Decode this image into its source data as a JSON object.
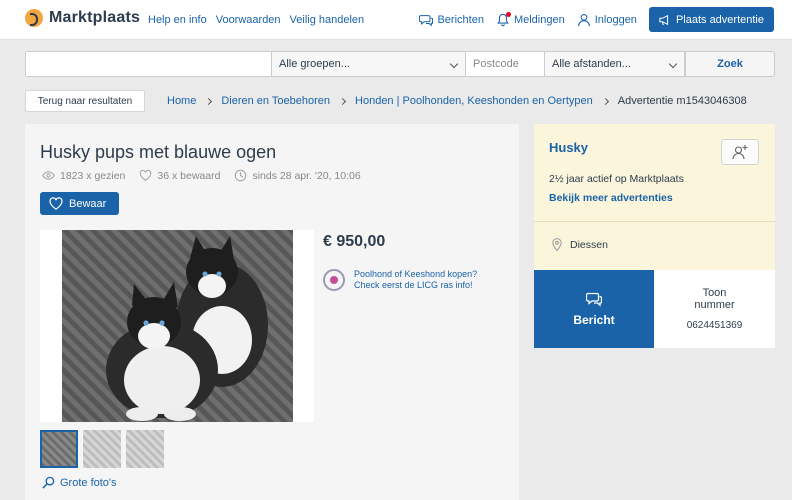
{
  "header": {
    "logo_text": "Marktplaats",
    "links": [
      "Help en info",
      "Voorwaarden",
      "Veilig handelen"
    ],
    "berichten": "Berichten",
    "meldingen": "Meldingen",
    "inloggen": "Inloggen",
    "plaats_advertentie": "Plaats advertentie"
  },
  "search": {
    "query_value": "",
    "group_select": "Alle groepen...",
    "postcode_placeholder": "Postcode",
    "distance_select": "Alle afstanden...",
    "button": "Zoek"
  },
  "breadcrumb": {
    "back": "Terug naar resultaten",
    "items": [
      "Home",
      "Dieren en Toebehoren",
      "Honden | Poolhonden, Keeshonden en Oertypen",
      "Advertentie m1543046308"
    ]
  },
  "ad": {
    "title": "Husky pups met blauwe ogen",
    "views": "1823 x gezien",
    "saved": "36 x bewaard",
    "since": "sinds 28 apr. '20, 10:06",
    "bewaar_button": "Bewaar",
    "price": "€ 950,00",
    "promo_line1": "Poolhond of Keeshond kopen?",
    "promo_line2": "Check eerst de LICG ras info!",
    "grote_fotos": "Grote foto's",
    "thumbnail_count": 3
  },
  "seller": {
    "name": "Husky",
    "active": "2½ jaar actief op Marktplaats",
    "more_ads": "Bekijk meer advertenties",
    "location": "Diessen",
    "bericht_button": "Bericht",
    "toon_line1": "Toon",
    "toon_line2": "nummer",
    "phone": "0624451369"
  },
  "colors": {
    "brand_blue": "#1a63a8",
    "logo_orange": "#f2a640",
    "seller_bg": "#fbf5dc",
    "notification_red": "#e4002b"
  }
}
